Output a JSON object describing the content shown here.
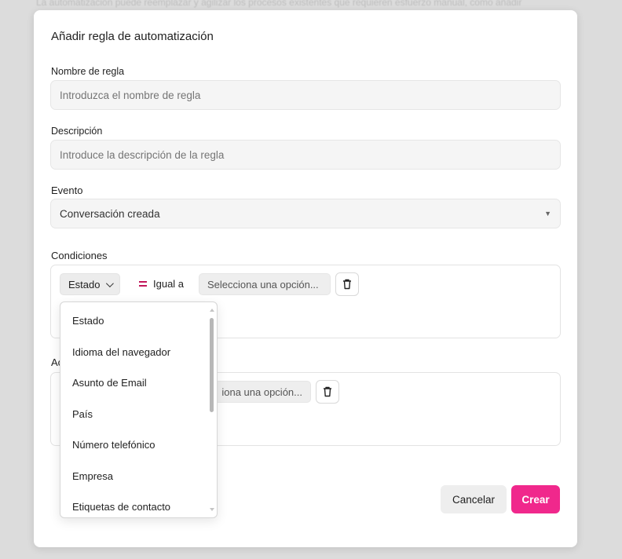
{
  "background": {
    "text": "La automatización puede reemplazar y agilizar los procesos existentes que requieren esfuerzo manual, como añadir"
  },
  "modal": {
    "title": "Añadir regla de automatización",
    "rule_name": {
      "label": "Nombre de regla",
      "placeholder": "Introduzca el nombre de regla"
    },
    "description": {
      "label": "Descripción",
      "placeholder": "Introduce la descripción de la regla"
    },
    "event": {
      "label": "Evento",
      "value": "Conversación creada"
    },
    "conditions": {
      "label": "Condiciones",
      "attribute": "Estado",
      "operator": "Igual a",
      "value_placeholder": "Selecciona una opción..."
    },
    "actions": {
      "label_visible": "Ac",
      "value_placeholder_visible": "iona una opción..."
    },
    "buttons": {
      "cancel": "Cancelar",
      "create": "Crear"
    },
    "accent_color": "#f0288c"
  },
  "dropdown": {
    "items": [
      "Estado",
      "Idioma del navegador",
      "Asunto de Email",
      "País",
      "Número telefónico",
      "Empresa",
      "Etiquetas de contacto"
    ]
  }
}
